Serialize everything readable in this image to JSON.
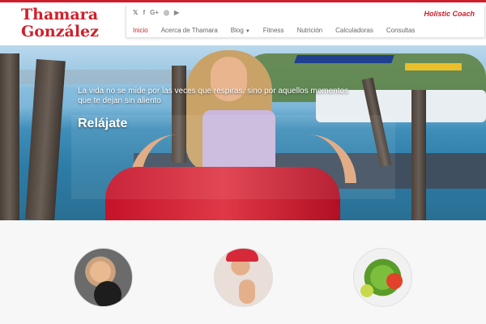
{
  "brand": {
    "name_line1": "Thamara",
    "name_line2": "González",
    "tagline": "Holistic Coach",
    "accent_color": "#d11f2a"
  },
  "social": [
    {
      "icon": "twitter-icon",
      "glyph": "𝕏"
    },
    {
      "icon": "facebook-icon",
      "glyph": "f"
    },
    {
      "icon": "google-plus-icon",
      "glyph": "G+"
    },
    {
      "icon": "instagram-icon",
      "glyph": "◎"
    },
    {
      "icon": "youtube-icon",
      "glyph": "▶"
    }
  ],
  "nav": {
    "items": [
      {
        "label": "Inicio",
        "active": true
      },
      {
        "label": "Acerca de Thamara"
      },
      {
        "label": "Blog",
        "dropdown": true
      },
      {
        "label": "Fitness"
      },
      {
        "label": "Nutrición"
      },
      {
        "label": "Calculadoras"
      },
      {
        "label": "Consultas"
      }
    ]
  },
  "hero": {
    "title": "Relájate",
    "text": "La vida no se mide por las veces que respiras, sino por aquellos momentos que te dejan sin aliento"
  },
  "features": [
    {
      "image": "boxing-woman-photo"
    },
    {
      "image": "woman-with-red-cap-photo"
    },
    {
      "image": "vegetables-photo"
    }
  ]
}
